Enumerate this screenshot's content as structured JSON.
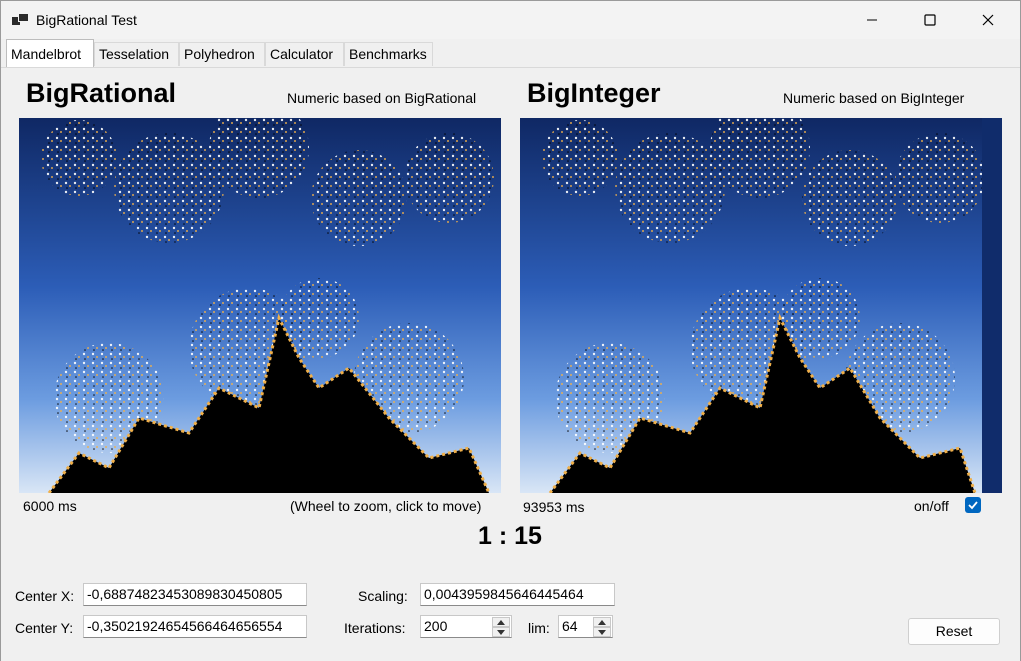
{
  "window": {
    "title": "BigRational Test"
  },
  "tabs": [
    "Mandelbrot",
    "Tesselation",
    "Polyhedron",
    "Calculator",
    "Benchmarks"
  ],
  "left_panel": {
    "title": "BigRational",
    "subtitle": "Numeric based on BigRational",
    "time": "6000 ms",
    "hint": "(Wheel to zoom, click to move)"
  },
  "right_panel": {
    "title": "BigInteger",
    "subtitle": "Numeric based on BigInteger",
    "time": "93953 ms",
    "toggle_label": "on/off",
    "toggle_checked": true
  },
  "ratio": "1 : 15",
  "controls": {
    "center_x_label": "Center X:",
    "center_x_value": "-0,688748234530898304508​05",
    "center_y_label": "Center Y:",
    "center_y_value": "-0,350219246545664646565​54",
    "scaling_label": "Scaling:",
    "scaling_value": "0,0043959845646445464",
    "iterations_label": "Iterations:",
    "iterations_value": "200",
    "lim_label": "lim:",
    "lim_value": "64",
    "reset_label": "Reset"
  },
  "colors": {
    "accent": "#0067c0",
    "fractal_deep": "#102c6b",
    "fractal_light": "#e8eef7",
    "fractal_gold": "#f0b04a"
  }
}
